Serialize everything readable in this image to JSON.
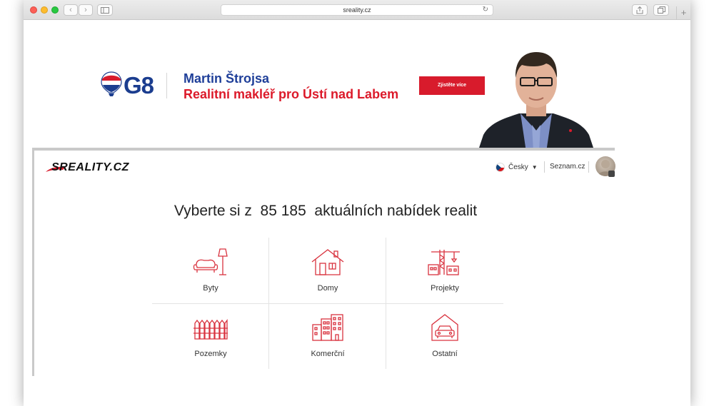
{
  "browser": {
    "url": "sreality.cz",
    "back_label": "‹",
    "forward_label": "›",
    "reload_label": "↻",
    "new_tab_label": "+"
  },
  "banner": {
    "brand": "G8",
    "agent_name": "Martin Štrojsa",
    "agent_role": "Realitní makléř pro Ústí nad Labem",
    "cta_label": "Zjistěte více",
    "accent_color": "#d81b2c",
    "brand_color": "#1f3f99"
  },
  "header": {
    "logo_text": "SREALITY.CZ",
    "language": "Česky",
    "seznam_link": "Seznam.cz"
  },
  "main": {
    "headline_prefix": "Vyberte si z",
    "offer_count": "85 185",
    "headline_suffix": "aktuálních nabídek realit",
    "categories": [
      {
        "label": "Byty",
        "icon": "armchair-lamp-icon"
      },
      {
        "label": "Domy",
        "icon": "house-icon"
      },
      {
        "label": "Projekty",
        "icon": "crane-icon"
      },
      {
        "label": "Pozemky",
        "icon": "fence-icon"
      },
      {
        "label": "Komerční",
        "icon": "office-buildings-icon"
      },
      {
        "label": "Ostatní",
        "icon": "garage-car-icon"
      }
    ]
  }
}
